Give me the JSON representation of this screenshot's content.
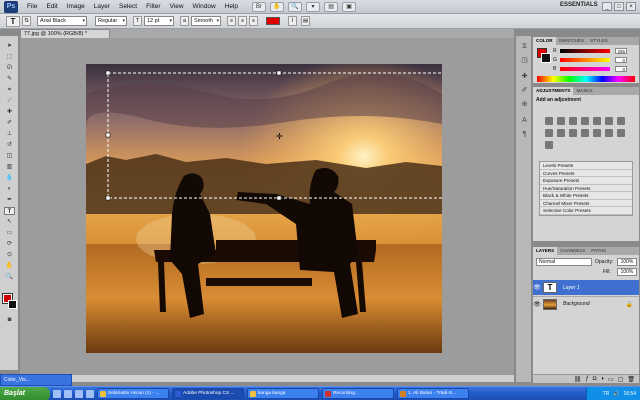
{
  "app": {
    "logo_text": "Ps",
    "menus": [
      "File",
      "Edit",
      "Image",
      "Layer",
      "Select",
      "Filter",
      "View",
      "Window",
      "Help"
    ],
    "workspace": "ESSENTIALS",
    "window_buttons": [
      "_",
      "□",
      "×"
    ]
  },
  "options": {
    "tool_glyph": "T",
    "font_family": "Arial Black",
    "font_style": "Regular",
    "font_size": "12 pt",
    "antialias": "Smooth",
    "text_color": "#e00000"
  },
  "document": {
    "tab_title": "77.jpg @ 100% (RGB/8) *",
    "status": "Doc: 1.49M/1.49M"
  },
  "panels": {
    "color": {
      "tabs": [
        "COLOR",
        "SWATCHES",
        "STYLES"
      ],
      "r": "255",
      "g": "0",
      "b": "0"
    },
    "adjustments": {
      "tabs": [
        "ADJUSTMENTS",
        "MASKS"
      ],
      "title": "Add an adjustment",
      "presets": [
        "Levels Presets",
        "Curves Presets",
        "Exposure Presets",
        "Hue/Saturation Presets",
        "Black & White Presets",
        "Channel Mixer Presets",
        "Selective Color Presets"
      ]
    },
    "layers": {
      "tabs": [
        "LAYERS",
        "CHANNELS",
        "PATHS"
      ],
      "blend_mode": "Normal",
      "opacity_label": "Opacity:",
      "opacity": "100%",
      "fill_label": "Fill:",
      "fill": "100%",
      "items": [
        {
          "name": "Layer 1",
          "thumb": "T",
          "selected": true
        },
        {
          "name": "Background",
          "thumb": "",
          "selected": false
        }
      ]
    }
  },
  "taskbar": {
    "start": "Başlat",
    "mini_window": "Color_Vis...",
    "tasks": [
      "Selahattin Akcan (1) - ...",
      "Adobe Photoshop CS ...",
      "kanga kanga",
      "Recording...",
      "1. Ali Batan - Trādi-S..."
    ],
    "lang": "TR",
    "time": "16:54"
  }
}
